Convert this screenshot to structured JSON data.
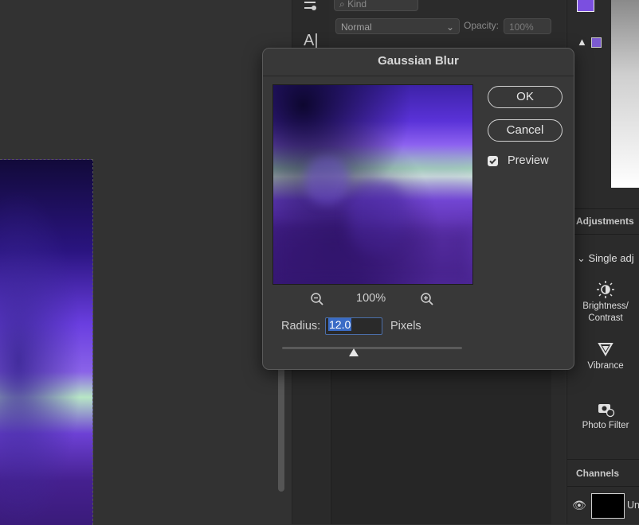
{
  "canvas": {
    "name": "document-canvas"
  },
  "layers_panel": {
    "blend_mode": "Normal",
    "opacity_label": "Opacity:",
    "opacity_value": "100%",
    "filter_kind": "Kind"
  },
  "right_panel": {
    "adjustments_header": "Adjustments",
    "single_adjustments": "Single adj",
    "adjustments": [
      {
        "label": "Brightness/\nContrast",
        "icon": "brightness-contrast-icon"
      },
      {
        "label": "Vibrance",
        "icon": "vibrance-icon"
      },
      {
        "label": "Photo Filter",
        "icon": "photo-filter-icon"
      }
    ],
    "brightness_line1": "Brightness/",
    "brightness_line2": "Contrast",
    "vibrance": "Vibrance",
    "photo_filter": "Photo Filter",
    "channels_header": "Channels",
    "channel_name": "Un"
  },
  "tools": {
    "type_tool": "A|"
  },
  "dialog": {
    "title": "Gaussian Blur",
    "ok_label": "OK",
    "cancel_label": "Cancel",
    "preview_label": "Preview",
    "preview_checked": true,
    "zoom_value": "100%",
    "radius_label": "Radius:",
    "radius_value": "12.0",
    "units_label": "Pixels",
    "slider_fraction": 0.4
  },
  "colors": {
    "foreground": "#7b4fe0",
    "background": "#ffffff",
    "accent": "#3a6cc6"
  }
}
